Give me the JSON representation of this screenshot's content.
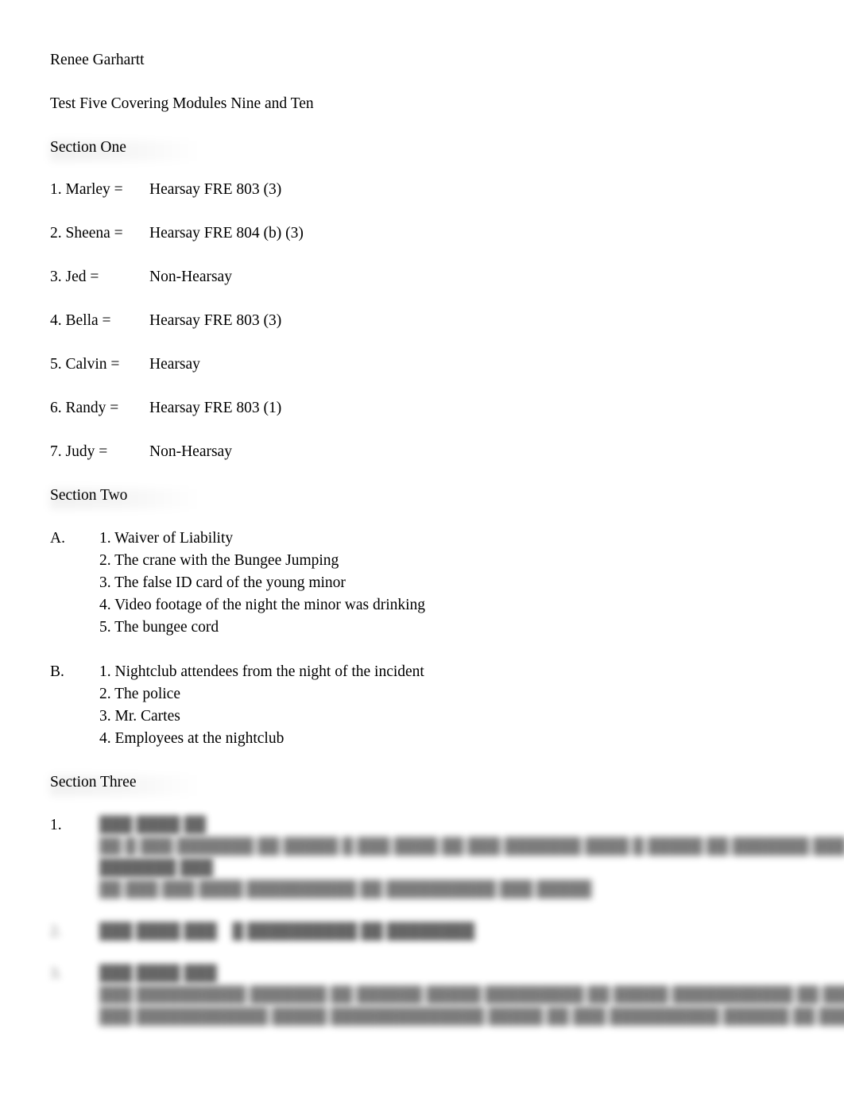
{
  "document": {
    "author_line": "Renee Garhartt",
    "title": "Test Five Covering Modules Nine and Ten"
  },
  "sections": {
    "one": {
      "heading": "Section One",
      "items": [
        {
          "key": "1. Marley =",
          "value": "Hearsay FRE 803 (3)"
        },
        {
          "key": "2. Sheena =",
          "value": "Hearsay FRE 804 (b) (3)"
        },
        {
          "key": "3. Jed =",
          "value": "Non-Hearsay"
        },
        {
          "key": "4. Bella =",
          "value": "Hearsay FRE 803 (3)"
        },
        {
          "key": "5. Calvin =",
          "value": "Hearsay"
        },
        {
          "key": "6. Randy =",
          "value": "Hearsay FRE 803 (1)"
        },
        {
          "key": "7. Judy =",
          "value": "Non-Hearsay"
        }
      ]
    },
    "two": {
      "heading": "Section Two",
      "groups": [
        {
          "label": "A.",
          "items": [
            "1. Waiver of Liability",
            "2. The crane with the Bungee Jumping",
            "3. The false ID card of the young minor",
            "4. Video footage of the night the minor was drinking",
            "5. The bungee cord"
          ]
        },
        {
          "label": "B.",
          "items": [
            "1. Nightclub attendees from the night of the incident",
            "2. The police",
            "3. Mr. Cartes",
            "4. Employees at the nightclub"
          ]
        }
      ]
    },
    "three": {
      "heading": "Section Three",
      "note": "Content below is blurred/illegible in the source image.",
      "items": [
        {
          "number": "1.",
          "number_legible": true,
          "lines": [
            "███ ████ ██",
            "██ █ ███ ███████ ██ █████ █ ███ ████ ██ ███ ███████ ████ █ █████ ██ ███████ ███",
            "███████ ███",
            "██ ███ ███ ████ ██████████ ██ ██████████ ███ █████"
          ]
        },
        {
          "number": "2.",
          "number_legible": false,
          "lines": [
            "███ ████ ███    █ ██████████ ██ ████████"
          ]
        },
        {
          "number": "3.",
          "number_legible": false,
          "lines": [
            "███ ████ ███",
            "███ ██████████ ███████ ██ ██████ █████ █████████ ██ █████ ███████████ ██ ██████ ██ ███ ████",
            "███ ████████████ █████ ██████████████ █████ ██ ███ ██████████ ██████ ██ ███ ████"
          ]
        }
      ]
    }
  }
}
